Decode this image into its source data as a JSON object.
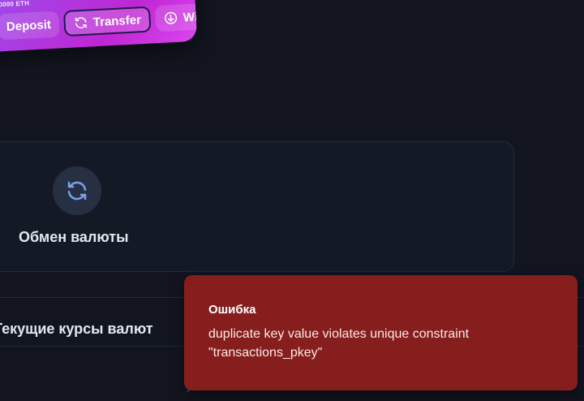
{
  "wallet_card": {
    "balance_text": "0000 ETH",
    "buttons": [
      {
        "label": "Deposit"
      },
      {
        "label": "Transfer"
      },
      {
        "label": "Withd"
      }
    ],
    "active_button": "Transfer"
  },
  "exchange": {
    "title": "Обмен валюты",
    "icon": "refresh-icon"
  },
  "rates": {
    "title": "Текущие курсы валют"
  },
  "footer": {
    "text": "у"
  },
  "toast": {
    "title": "Ошибка",
    "message": "duplicate key value violates unique constraint \"transactions_pkey\""
  },
  "colors": {
    "background": "#12151f",
    "card_gradient_start": "#8b5cf6",
    "card_gradient_end": "#d946ef",
    "toast_bg": "#861e1e",
    "icon_accent": "#7aa2e8"
  }
}
